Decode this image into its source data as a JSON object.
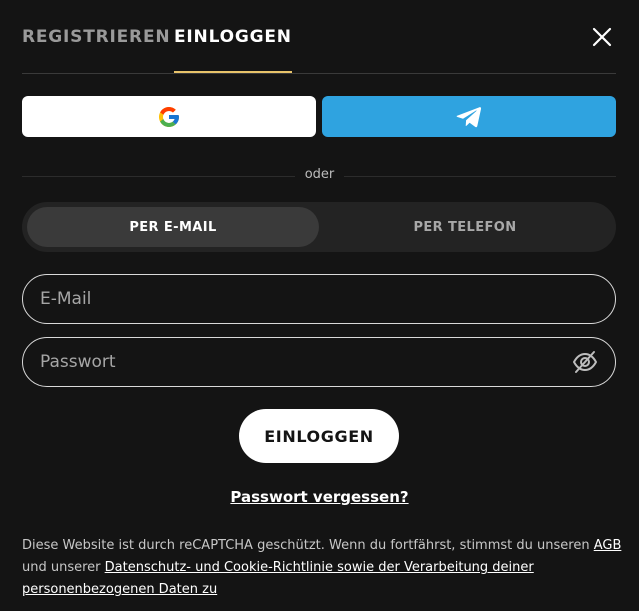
{
  "tabs": {
    "register_label": "REGISTRIEREN",
    "login_label": "EINLOGGEN",
    "active": "EINLOGGEN"
  },
  "colors": {
    "background": "#141414",
    "accent_underline": "#e8c36a",
    "telegram": "#2fa3e0",
    "google_button": "#ffffff"
  },
  "icons": {
    "close": "close-icon",
    "google": "google-icon",
    "telegram": "telegram-icon",
    "password_visibility": "eye-off-icon"
  },
  "divider": {
    "text": "oder"
  },
  "method": {
    "email_label": "PER E-MAIL",
    "phone_label": "PER TELEFON",
    "selected": "PER E-MAIL"
  },
  "form": {
    "email_placeholder": "E-Mail",
    "email_value": "",
    "password_placeholder": "Passwort",
    "password_value": "",
    "submit_label": "EINLOGGEN",
    "forgot_label": "Passwort vergessen?"
  },
  "legal": {
    "text_before": "Diese Website ist durch reCAPTCHA geschützt. Wenn du fortfährst, stimmst du unseren ",
    "agb_link": "AGB",
    "text_middle": " und unserer ",
    "privacy_link": "Datenschutz- und Cookie-Richtlinie sowie der Verarbeitung deiner personenbezogenen Daten zu"
  }
}
